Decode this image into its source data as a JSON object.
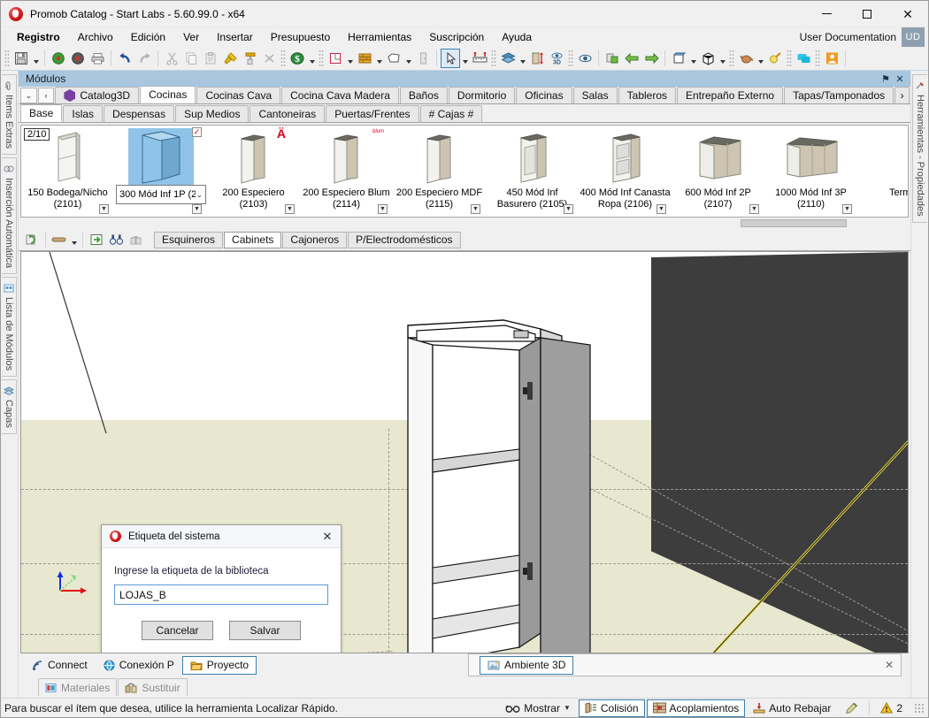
{
  "window": {
    "title": "Promob Catalog - Start Labs - 5.60.99.0 - x64",
    "minimize": "─",
    "maximize": "☐",
    "close": "✕"
  },
  "menubar": {
    "items": [
      {
        "label": "Registro",
        "bold": true
      },
      {
        "label": "Archivo",
        "bold": false
      },
      {
        "label": "Edición",
        "bold": false
      },
      {
        "label": "Ver",
        "bold": false
      },
      {
        "label": "Insertar",
        "bold": false
      },
      {
        "label": "Presupuesto",
        "bold": false
      },
      {
        "label": "Herramientas",
        "bold": false
      },
      {
        "label": "Suscripción",
        "bold": false
      },
      {
        "label": "Ayuda",
        "bold": false
      }
    ],
    "user_documentation": "User Documentation",
    "user_badge": "UD"
  },
  "toolbar": {
    "icons": [
      "save-icon",
      "open-green-icon",
      "open-red-icon",
      "print-icon",
      "undo-icon",
      "redo-icon",
      "cut-icon",
      "copy-icon",
      "paste-icon",
      "hammer-icon",
      "paint-roller-icon",
      "delete-icon",
      "currency-icon",
      "room-plan-icon",
      "wall-icon",
      "polygon-icon",
      "door-icon",
      "select-arrow-icon",
      "measure-icon",
      "layers-icon",
      "height-icon",
      "view3d-icon",
      "eye-icon",
      "render-icon",
      "arrow-left-icon",
      "arrow-right-icon",
      "box-open-icon",
      "box-closed-icon",
      "teapot-icon",
      "light-bulb-icon",
      "chat-icon",
      "user-icon"
    ]
  },
  "left_rail": {
    "tabs": [
      {
        "label": "Items Extras",
        "icon": "clip-icon"
      },
      {
        "label": "Inserción Automática",
        "icon": "auto-insert-icon"
      },
      {
        "label": "Lista de Módulos",
        "icon": "module-list-icon"
      },
      {
        "label": "Capas",
        "icon": "layers-icon"
      }
    ]
  },
  "right_rail": {
    "tabs": [
      {
        "label": "Herramientas - Propiedades",
        "icon": "tools-icon"
      }
    ]
  },
  "modules_panel": {
    "title": "Módulos",
    "pin_label": "⚑",
    "close_label": "✕",
    "nav_down": "⌄",
    "nav_prev": "‹",
    "catalog_tab": "Catalog3D",
    "category_tabs": [
      {
        "label": "Cocinas",
        "selected": true
      },
      {
        "label": "Cocinas Cava",
        "selected": false
      },
      {
        "label": "Cocina Cava Madera",
        "selected": false
      },
      {
        "label": "Baños",
        "selected": false
      },
      {
        "label": "Dormitorio",
        "selected": false
      },
      {
        "label": "Oficinas",
        "selected": false
      },
      {
        "label": "Salas",
        "selected": false
      },
      {
        "label": "Tableros",
        "selected": false
      },
      {
        "label": "Entrepaño Externo",
        "selected": false
      },
      {
        "label": "Tapas/Tamponados",
        "selected": false
      }
    ],
    "category_more": "›",
    "sub_tabs": [
      {
        "label": "Base",
        "selected": true
      },
      {
        "label": "Islas",
        "selected": false
      },
      {
        "label": "Despensas",
        "selected": false
      },
      {
        "label": "Sup Medios",
        "selected": false
      },
      {
        "label": "Cantoneiras",
        "selected": false
      },
      {
        "label": "Puertas/Frentes",
        "selected": false
      },
      {
        "label": "# Cajas #",
        "selected": false
      }
    ],
    "page_indicator": "2/10",
    "items": [
      {
        "label": "150 Bodega/Nicho (2101)",
        "selected": false,
        "badge": "",
        "has_expand": true
      },
      {
        "label": "300 Mód Inf 1P (2",
        "selected": true,
        "badge": "check",
        "has_expand": true,
        "combo": true,
        "chevron": "⌄"
      },
      {
        "label": "200 Especiero (2103)",
        "selected": false,
        "badge": "brand-a",
        "has_expand": true
      },
      {
        "label": "200 Especiero Blum (2114)",
        "selected": false,
        "badge": "blum",
        "has_expand": true
      },
      {
        "label": "200 Especiero MDF (2115)",
        "selected": false,
        "badge": "",
        "has_expand": true
      },
      {
        "label": "450 Mód Inf Basurero (2105)",
        "selected": false,
        "badge": "",
        "has_expand": true
      },
      {
        "label": "400 Mód Inf Canasta Ropa (2106)",
        "selected": false,
        "badge": "",
        "has_expand": true
      },
      {
        "label": "600 Mód Inf 2P (2107)",
        "selected": false,
        "badge": "",
        "has_expand": true
      },
      {
        "label": "1000 Mód Inf 3P (2110)",
        "selected": false,
        "badge": "",
        "has_expand": true
      },
      {
        "label": "Termin",
        "selected": false,
        "badge": "",
        "has_expand": false
      }
    ]
  },
  "mini_toolbar": {
    "icons": [
      "refresh-module-icon",
      "color-bar-icon",
      "insert-icon",
      "binoculars-icon",
      "lock-icon"
    ],
    "tabs": [
      {
        "label": "Esquineros",
        "selected": false
      },
      {
        "label": "Cabinets",
        "selected": true
      },
      {
        "label": "Cajoneros",
        "selected": false
      },
      {
        "label": "P/Electrodomésticos",
        "selected": false
      }
    ]
  },
  "dialog": {
    "title": "Etiqueta del sistema",
    "close": "✕",
    "label": "Ingrese la etiqueta de la biblioteca",
    "input_value": "LOJAS_B",
    "input_placeholder": "",
    "cancel_button": "Cancelar",
    "save_button": "Salvar"
  },
  "bottom_tabs": {
    "left": [
      {
        "label": "Connect",
        "icon": "rss-icon",
        "selected": false
      },
      {
        "label": "Conexión P",
        "icon": "globe-icon",
        "selected": false
      },
      {
        "label": "Proyecto",
        "icon": "folder-icon",
        "selected": true
      }
    ],
    "viewport_tab": {
      "label": "Ambiente 3D",
      "icon": "scene-icon",
      "close": "✕"
    },
    "row2": [
      {
        "label": "Materiales",
        "icon": "materials-icon"
      },
      {
        "label": "Sustituir",
        "icon": "replace-icon"
      }
    ]
  },
  "statusbar": {
    "message": "Para buscar el ítem que desea, utilice la herramienta Localizar Rápido.",
    "buttons": [
      {
        "label": "Mostrar",
        "icon": "glasses-icon",
        "framed": false,
        "caret": true
      },
      {
        "label": "Colisión",
        "icon": "collision-icon",
        "framed": true,
        "caret": false
      },
      {
        "label": "Acoplamientos",
        "icon": "docking-icon",
        "framed": true,
        "caret": false
      },
      {
        "label": "Auto Rebajar",
        "icon": "auto-trim-icon",
        "framed": false,
        "caret": false
      }
    ],
    "pencil_icon": "pencil-icon",
    "warning_icon": "warning-icon",
    "warning_count": "2"
  },
  "colors": {
    "panel_title_bg": "#a8c6de",
    "selection_blue": "#8fc4e8",
    "accent_border": "#3c7fb1",
    "floor": "#e8e8d0",
    "wall_dark": "#3d3d3d",
    "brand_red": "#d6001c"
  }
}
